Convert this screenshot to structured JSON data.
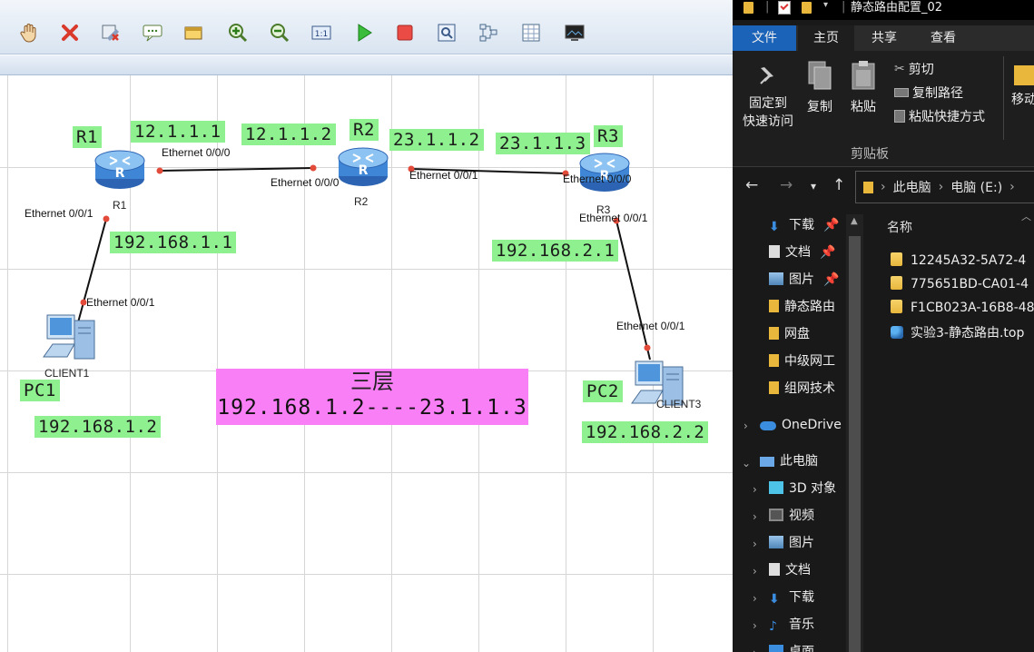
{
  "topology": {
    "routers": [
      {
        "id": "R1",
        "label": "R1",
        "tag": "R1"
      },
      {
        "id": "R2",
        "label": "R2",
        "tag": "R2"
      },
      {
        "id": "R3",
        "label": "R3",
        "tag": "R3"
      }
    ],
    "clients": [
      {
        "id": "PC1",
        "label": "CLIENT1",
        "tag": "PC1"
      },
      {
        "id": "PC2",
        "label": "CLIENT3",
        "tag": "PC2"
      }
    ],
    "ip_labels": {
      "r1_e0": "12.1.1.1",
      "r2_e0": "12.1.1.2",
      "r2_e1": "23.1.1.2",
      "r3_e0": "23.1.1.3",
      "r1_e1": "192.168.1.1",
      "r3_e1": "192.168.2.1",
      "pc1": "192.168.1.2",
      "pc2": "192.168.2.2"
    },
    "ports": {
      "r1_e000": "Ethernet 0/0/0",
      "r2_e000": "Ethernet 0/0/0",
      "r2_e001": "Ethernet 0/0/1",
      "r3_e000": "Ethernet 0/0/0",
      "r1_e001": "Ethernet 0/0/1",
      "r3_e001": "Ethernet 0/0/1",
      "pc1_e001": "Ethernet 0/0/1",
      "pc2_e001": "Ethernet 0/0/1"
    },
    "note": {
      "line1": "三层",
      "line2": "192.168.1.2----23.1.1.3"
    }
  },
  "explorer": {
    "window_title": "静态路由配置_02",
    "tabs": [
      "文件",
      "主页",
      "共享",
      "查看"
    ],
    "active_tab": "主页",
    "ribbon": {
      "pin_label_1": "固定到",
      "pin_label_2": "快速访问",
      "copy": "复制",
      "paste": "粘贴",
      "cut": "剪切",
      "copy_path": "复制路径",
      "paste_shortcut": "粘贴快捷方式",
      "move_to": "移动",
      "group": "剪贴板"
    },
    "address": [
      "此电脑",
      "电脑 (E:)"
    ],
    "nav": [
      {
        "label": "下载",
        "pinned": true
      },
      {
        "label": "文档",
        "pinned": true
      },
      {
        "label": "图片",
        "pinned": true
      },
      {
        "label": "静态路由"
      },
      {
        "label": "网盘"
      },
      {
        "label": "中级网工"
      },
      {
        "label": "组网技术"
      },
      {
        "label": "OneDrive"
      },
      {
        "label": "此电脑"
      },
      {
        "label": "3D 对象"
      },
      {
        "label": "视频"
      },
      {
        "label": "图片"
      },
      {
        "label": "文档"
      },
      {
        "label": "下载"
      },
      {
        "label": "音乐"
      },
      {
        "label": "桌面"
      }
    ],
    "column_name": "名称",
    "files": [
      {
        "name": "12245A32-5A72-4"
      },
      {
        "name": "775651BD-CA01-4"
      },
      {
        "name": "F1CB023A-16B8-48"
      },
      {
        "name": "实验3-静态路由.top"
      }
    ]
  }
}
